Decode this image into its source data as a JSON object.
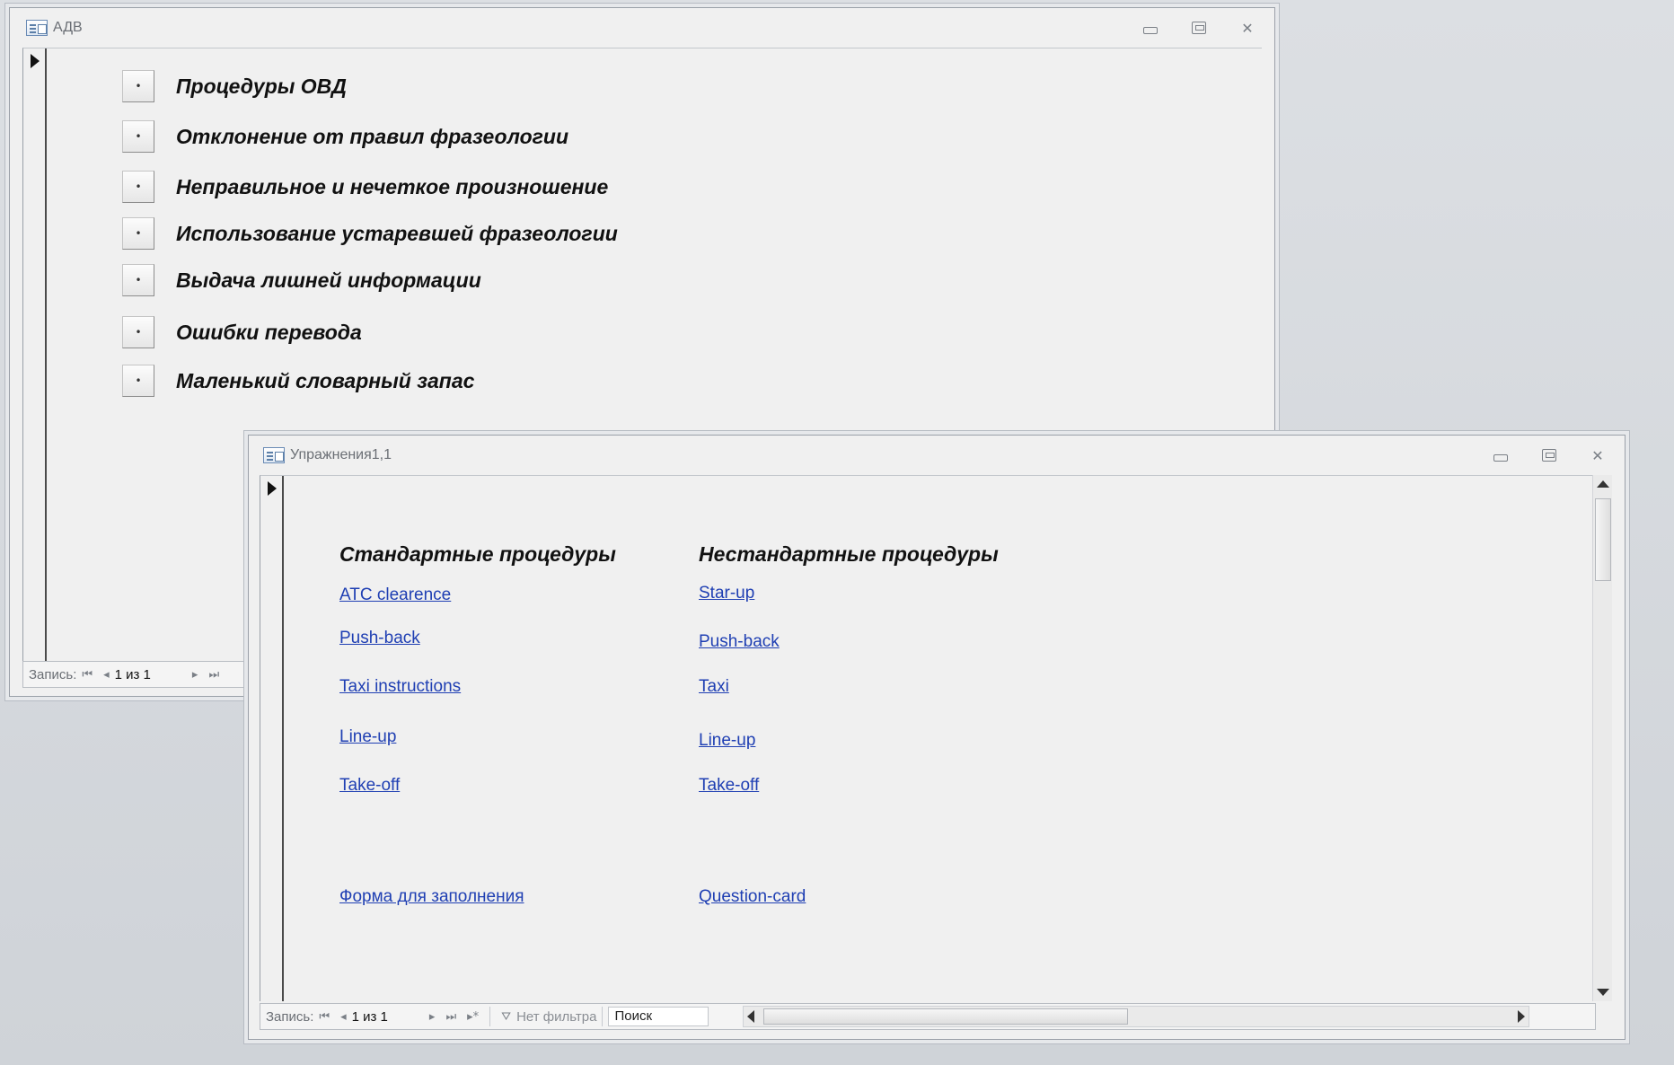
{
  "window1": {
    "title": "АДВ",
    "menu_items": [
      {
        "button_label": "•",
        "label": "Процедуры ОВД"
      },
      {
        "button_label": "•",
        "label": "Отклонение от правил фразеологии"
      },
      {
        "button_label": "•",
        "label": "Неправильное и нечеткое произношение"
      },
      {
        "button_label": "•",
        "label": "Использование устаревшей фразеологии"
      },
      {
        "button_label": "•",
        "label": "Выдача лишней информации"
      },
      {
        "button_label": "•",
        "label": "Ошибки перевода"
      },
      {
        "button_label": "•",
        "label": "Маленький словарный запас"
      }
    ],
    "nav": {
      "label": "Запись:",
      "record": "1 из 1"
    }
  },
  "window2": {
    "title": "Упражнения1,1",
    "standard": {
      "heading": "Стандартные процедуры",
      "links": [
        "ATC clearence",
        "Push-back",
        "Taxi instructions",
        "Line-up",
        "Take-off"
      ],
      "extra_link": "Форма для заполнения"
    },
    "nonstandard": {
      "heading": "Нестандартные процедуры",
      "links": [
        "Star-up",
        "Push-back",
        "Taxi",
        "Line-up",
        "Take-off"
      ],
      "extra_link": "Question-card"
    },
    "nav": {
      "label": "Запись:",
      "record": "1 из 1",
      "filter": "Нет фильтра",
      "search": "Поиск"
    }
  },
  "icons": {
    "minimize": "minimize-icon",
    "restore": "restore-icon",
    "close": "close-icon",
    "first_record": "first-record-icon",
    "prev_record": "prev-record-icon",
    "next_record": "next-record-icon",
    "last_record": "last-record-icon",
    "new_record": "new-record-icon",
    "filter": "filter-icon"
  },
  "colors": {
    "link": "#1f3fb3",
    "background": "#f0f0f0",
    "desktop": "#d4d7db"
  }
}
